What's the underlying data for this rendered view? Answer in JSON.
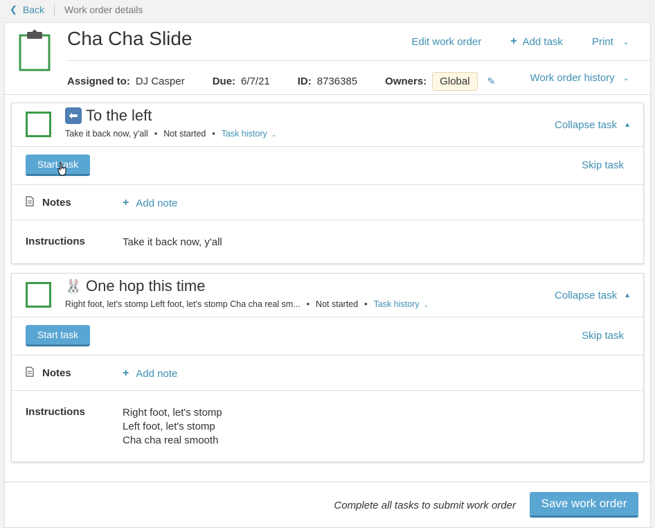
{
  "topbar": {
    "back_label": "Back",
    "breadcrumb": "Work order details"
  },
  "header": {
    "title": "Cha Cha Slide",
    "edit_label": "Edit work order",
    "add_task_label": "Add task",
    "print_label": "Print",
    "assigned_label": "Assigned to:",
    "assigned_value": "DJ Casper",
    "due_label": "Due:",
    "due_value": "6/7/21",
    "id_label": "ID:",
    "id_value": "8736385",
    "owners_label": "Owners:",
    "owners_value": "Global",
    "history_label": "Work order history"
  },
  "tasks": [
    {
      "icon": "back-arrow-emoji",
      "title": "To the left",
      "summary": "Take it back now, y'all",
      "status": "Not started",
      "history_label": "Task history",
      "collapse_label": "Collapse task",
      "start_label": "Start task",
      "skip_label": "Skip task",
      "notes_label": "Notes",
      "add_note_label": "Add note",
      "instructions_label": "Instructions",
      "instructions": [
        "Take it back now, y'all"
      ]
    },
    {
      "icon": "rabbit-emoji",
      "title": "One hop this time",
      "summary": "Right foot, let's stomp Left foot, let's stomp Cha cha real sm...",
      "status": "Not started",
      "history_label": "Task history",
      "collapse_label": "Collapse task",
      "start_label": "Start task",
      "skip_label": "Skip task",
      "notes_label": "Notes",
      "add_note_label": "Add note",
      "instructions_label": "Instructions",
      "instructions": [
        "Right foot, let's stomp",
        "Left foot, let's stomp",
        "Cha cha real smooth"
      ]
    }
  ],
  "footer": {
    "message": "Complete all tasks to submit work order",
    "save_label": "Save work order"
  },
  "colors": {
    "accent": "#3f8fb3",
    "button": "#5aa6d3",
    "check_border": "#3d9a4b",
    "owner_pill": "#fdf7e4"
  }
}
